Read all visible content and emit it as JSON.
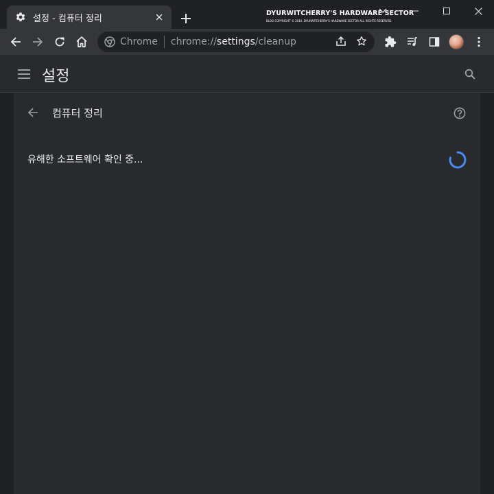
{
  "browser": {
    "tab": {
      "title": "설정 - 컴퓨터 정리",
      "icon": "gear-icon"
    },
    "watermark": {
      "title": "DYURWITCHERRY'S HARDWARE SECTOR",
      "subtitle": "BLOG COPYRIGHT © 2010. DYURWITCHERRY'S HARDWARE SECTOR ALL RIGHTS RESERVED."
    },
    "omnibox": {
      "chip": "Chrome",
      "url_scheme": "chrome://",
      "url_host": "settings",
      "url_path": "/cleanup"
    }
  },
  "settings": {
    "title": "설정",
    "subpage_title": "컴퓨터 정리",
    "status": "유해한 소프트웨어 확인 중..."
  },
  "colors": {
    "accent": "#8ab4f8",
    "spinner": "#4a8af4",
    "page_bg": "#202124",
    "card_bg": "#292a2d"
  }
}
